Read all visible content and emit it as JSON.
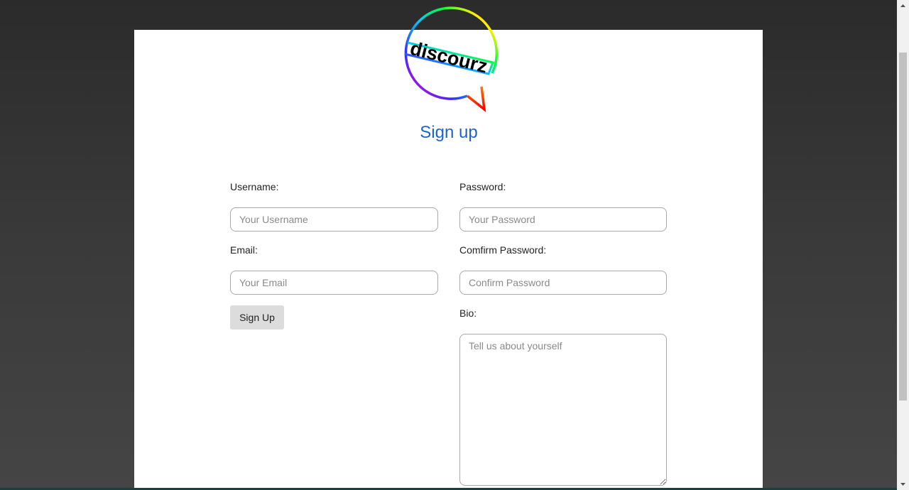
{
  "logo": {
    "text": "discourz"
  },
  "page": {
    "title": "Sign up"
  },
  "form": {
    "username": {
      "label": "Username:",
      "placeholder": "Your Username",
      "value": ""
    },
    "password": {
      "label": "Password:",
      "placeholder": "Your Password",
      "value": ""
    },
    "email": {
      "label": "Email:",
      "placeholder": "Your Email",
      "value": ""
    },
    "confirm_password": {
      "label": "Comfirm Password:",
      "placeholder": "Confirm Password",
      "value": ""
    },
    "bio": {
      "label": "Bio:",
      "placeholder": "Tell us about yourself",
      "value": ""
    },
    "submit_label": "Sign Up"
  },
  "colors": {
    "title": "#1d63c9",
    "button_bg": "#dcdcdc",
    "page_bg": "#ffffff",
    "backdrop": "#333333"
  },
  "icons": {
    "logo": "discourz-speech-bubble-logo",
    "scroll_up": "chevron-up-icon",
    "scroll_down": "chevron-down-icon"
  }
}
